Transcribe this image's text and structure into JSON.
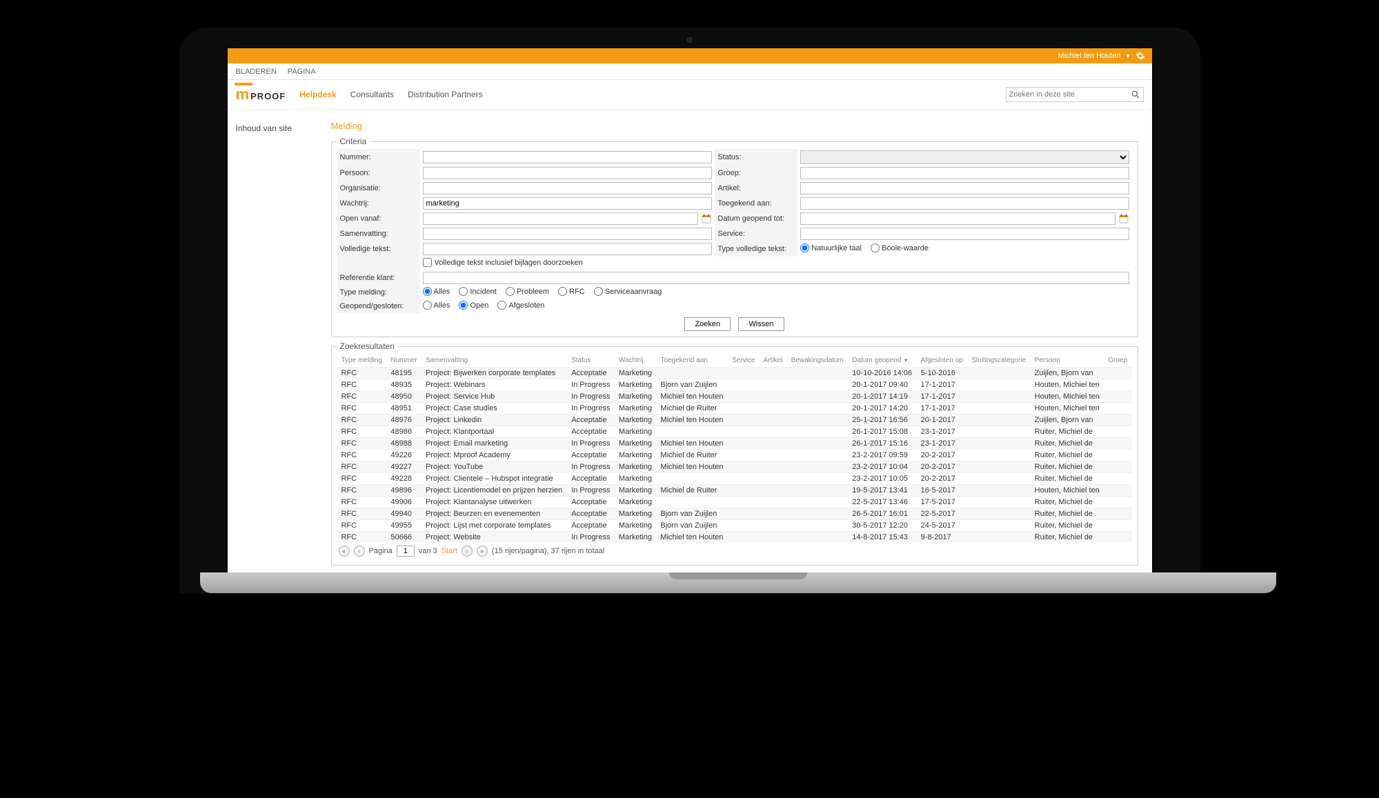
{
  "top": {
    "user": "Michiel ten Houten"
  },
  "ribbon": {
    "tab1": "BLADEREN",
    "tab2": "PAGINA"
  },
  "logo": {
    "m": "m",
    "text": "PROOF"
  },
  "nav": {
    "helpdesk": "Helpdesk",
    "consultants": "Consultants",
    "distribution": "Distribution Partners"
  },
  "search": {
    "placeholder": "Zoeken in deze site"
  },
  "sidebar": {
    "link": "Inhoud van site"
  },
  "page_title": "Melding",
  "criteria": {
    "legend": "Criteria",
    "nummer": "Nummer:",
    "status": "Status:",
    "persoon": "Persoon:",
    "groep": "Groep:",
    "organisatie": "Organisatie:",
    "artikel": "Artikel:",
    "wachtrij": "Wachtrij:",
    "wachtrij_value": "marketing",
    "toegekend": "Toegekend aan:",
    "open_vanaf": "Open vanaf:",
    "datum_tot": "Datum geopend tot:",
    "samenvatting": "Samenvatting:",
    "service": "Service:",
    "volledige": "Volledige tekst:",
    "type_volledige": "Type volledige tekst:",
    "natuurlijke": "Natuurlijke taal",
    "boole": "Boole-waarde",
    "include_attach": "Volledige tekst inclusief bijlagen doorzoeken",
    "referentie": "Referentie klant:",
    "type_melding": "Type melding:",
    "tm_alles": "Alles",
    "tm_incident": "Incident",
    "tm_probleem": "Probleem",
    "tm_rfc": "RFC",
    "tm_service": "Serviceaanvraag",
    "gg": "Geopend/gesloten:",
    "gg_alles": "Alles",
    "gg_open": "Open",
    "gg_afg": "Afgesloten",
    "zoeken": "Zoeken",
    "wissen": "Wissen"
  },
  "results": {
    "legend": "Zoekresultaten",
    "headers": {
      "type": "Type melding",
      "nummer": "Nummer",
      "samenvatting": "Samenvatting",
      "status": "Status",
      "wachtrij": "Wachtrij",
      "toegekend": "Toegekend aan",
      "service": "Service",
      "artikel": "Artikel",
      "bewaking": "Bewakingsdatum",
      "geopend": "Datum geopend",
      "afgesloten": "Afgesloten op",
      "sluiting": "Sluitingscategorie",
      "persoon": "Persoon",
      "groep": "Groep"
    },
    "rows": [
      {
        "type": "RFC",
        "nummer": "48195",
        "samenvatting": "Project: Bijwerken corporate templates",
        "status": "Acceptatie",
        "wachtrij": "Marketing",
        "toegekend": "",
        "geopend": "10-10-2016 14:06",
        "afgesloten": "5-10-2016",
        "persoon": "Zuijlen, Bjorn van"
      },
      {
        "type": "RFC",
        "nummer": "48935",
        "samenvatting": "Project: Webinars",
        "status": "In Progress",
        "wachtrij": "Marketing",
        "toegekend": "Bjorn van Zuijlen",
        "geopend": "20-1-2017 09:40",
        "afgesloten": "17-1-2017",
        "persoon": "Houten, Michiel ten"
      },
      {
        "type": "RFC",
        "nummer": "48950",
        "samenvatting": "Project: Service Hub",
        "status": "In Progress",
        "wachtrij": "Marketing",
        "toegekend": "Michiel ten Houten",
        "geopend": "20-1-2017 14:19",
        "afgesloten": "17-1-2017",
        "persoon": "Houten, Michiel ten"
      },
      {
        "type": "RFC",
        "nummer": "48951",
        "samenvatting": "Project: Case studies",
        "status": "In Progress",
        "wachtrij": "Marketing",
        "toegekend": "Michiel de Ruiter",
        "geopend": "20-1-2017 14:20",
        "afgesloten": "17-1-2017",
        "persoon": "Houten, Michiel ten"
      },
      {
        "type": "RFC",
        "nummer": "48976",
        "samenvatting": "Project: Linkedin",
        "status": "Acceptatie",
        "wachtrij": "Marketing",
        "toegekend": "Michiel ten Houten",
        "geopend": "25-1-2017 16:56",
        "afgesloten": "20-1-2017",
        "persoon": "Zuijlen, Bjorn van"
      },
      {
        "type": "RFC",
        "nummer": "48986",
        "samenvatting": "Project: Klantportaal",
        "status": "Acceptatie",
        "wachtrij": "Marketing",
        "toegekend": "",
        "geopend": "26-1-2017 15:08",
        "afgesloten": "23-1-2017",
        "persoon": "Ruiter, Michiel de"
      },
      {
        "type": "RFC",
        "nummer": "48988",
        "samenvatting": "Project: Email marketing",
        "status": "In Progress",
        "wachtrij": "Marketing",
        "toegekend": "Michiel ten Houten",
        "geopend": "26-1-2017 15:16",
        "afgesloten": "23-1-2017",
        "persoon": "Ruiter, Michiel de"
      },
      {
        "type": "RFC",
        "nummer": "49226",
        "samenvatting": "Project: Mproof Academy",
        "status": "Acceptatie",
        "wachtrij": "Marketing",
        "toegekend": "Michiel de Ruiter",
        "geopend": "23-2-2017 09:59",
        "afgesloten": "20-2-2017",
        "persoon": "Ruiter, Michiel de"
      },
      {
        "type": "RFC",
        "nummer": "49227",
        "samenvatting": "Project: YouTube",
        "status": "In Progress",
        "wachtrij": "Marketing",
        "toegekend": "Michiel ten Houten",
        "geopend": "23-2-2017 10:04",
        "afgesloten": "20-2-2017",
        "persoon": "Ruiter, Michiel de"
      },
      {
        "type": "RFC",
        "nummer": "49228",
        "samenvatting": "Project: Clientele – Hubspot integratie",
        "status": "Acceptatie",
        "wachtrij": "Marketing",
        "toegekend": "",
        "geopend": "23-2-2017 10:05",
        "afgesloten": "20-2-2017",
        "persoon": "Ruiter, Michiel de"
      },
      {
        "type": "RFC",
        "nummer": "49896",
        "samenvatting": "Project: Licentiemodel en prijzen herzien",
        "status": "In Progress",
        "wachtrij": "Marketing",
        "toegekend": "Michiel de Ruiter",
        "geopend": "19-5-2017 13:41",
        "afgesloten": "16-5-2017",
        "persoon": "Houten, Michiel ten"
      },
      {
        "type": "RFC",
        "nummer": "49906",
        "samenvatting": "Project: Klantanalyse uitwerken",
        "status": "Acceptatie",
        "wachtrij": "Marketing",
        "toegekend": "",
        "geopend": "22-5-2017 13:46",
        "afgesloten": "17-5-2017",
        "persoon": "Ruiter, Michiel de"
      },
      {
        "type": "RFC",
        "nummer": "49940",
        "samenvatting": "Project: Beurzen en evenementen",
        "status": "Acceptatie",
        "wachtrij": "Marketing",
        "toegekend": "Bjorn van Zuijlen",
        "geopend": "26-5-2017 16:01",
        "afgesloten": "22-5-2017",
        "persoon": "Ruiter, Michiel de"
      },
      {
        "type": "RFC",
        "nummer": "49955",
        "samenvatting": "Project: Lijst met corporate templates",
        "status": "Acceptatie",
        "wachtrij": "Marketing",
        "toegekend": "Bjorn van Zuijlen",
        "geopend": "30-5-2017 12:20",
        "afgesloten": "24-5-2017",
        "persoon": "Ruiter, Michiel de"
      },
      {
        "type": "RFC",
        "nummer": "50666",
        "samenvatting": "Project: Website",
        "status": "In Progress",
        "wachtrij": "Marketing",
        "toegekend": "Michiel ten Houten",
        "geopend": "14-8-2017 15:43",
        "afgesloten": "9-8-2017",
        "persoon": "Ruiter, Michiel de"
      }
    ]
  },
  "pager": {
    "pagina": "Pagina",
    "value": "1",
    "van": "van 3",
    "start": "Start",
    "info": "(15 rijen/pagina), 37 rijen in totaal"
  }
}
